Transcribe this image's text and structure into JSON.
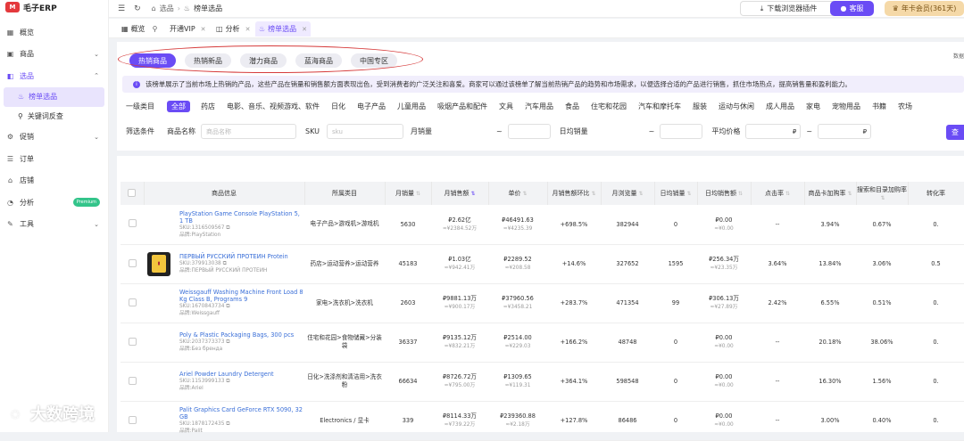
{
  "app": {
    "logo_mark": "M",
    "name": "毛子ERP"
  },
  "sidebar": {
    "items": [
      {
        "label": "概览",
        "icon": "grid-icon"
      },
      {
        "label": "商品",
        "icon": "box-icon"
      },
      {
        "label": "选品",
        "icon": "bag-icon"
      },
      {
        "label": "榜单选品",
        "icon": "flame-icon"
      },
      {
        "label": "关键词反查",
        "icon": "search-icon"
      },
      {
        "label": "促销",
        "icon": "gear-icon"
      },
      {
        "label": "订单",
        "icon": "list-icon"
      },
      {
        "label": "店铺",
        "icon": "store-icon"
      },
      {
        "label": "分析",
        "icon": "chart-icon",
        "badge": "Premium"
      },
      {
        "label": "工具",
        "icon": "wrench-icon"
      }
    ]
  },
  "topbar": {
    "breadcrumb": [
      "选品",
      "榜单选品"
    ],
    "download_label": "下载浏览器插件",
    "service_label": "客服",
    "vip_label": "年卡会员(361天)"
  },
  "tabs": [
    {
      "label": "概览"
    },
    {
      "label": "开通VIP"
    },
    {
      "label": "分析"
    },
    {
      "label": "榜单选品"
    }
  ],
  "sub_tabs": [
    "热销商品",
    "热销新品",
    "潜力商品",
    "蓝海商品",
    "中国专区"
  ],
  "data_source": "数据",
  "notice": "该榜单展示了当前市场上热销的产品，这些产品在销量和销售额方面表现出色，受到消费者的广泛关注和喜爱。商家可以通过该榜单了解当前热销产品的趋势和市场需求，以便选择合适的产品进行销售，抓住市场热点，提高销售量和盈利能力。",
  "categories": {
    "label": "一级类目",
    "items": [
      "全部",
      "药店",
      "电影、音乐、视频游戏、软件",
      "日化",
      "电子产品",
      "儿童用品",
      "吸烟产品和配件",
      "文具",
      "汽车用品",
      "食品",
      "住宅和花园",
      "汽车和摩托车",
      "服装",
      "运动与休闲",
      "成人用品",
      "家电",
      "宠物用品",
      "书籍",
      "农场"
    ]
  },
  "filters": {
    "label": "筛选条件",
    "name_label": "商品名称",
    "name_placeholder": "商品名称",
    "sku_label": "SKU",
    "sku_placeholder": "sku",
    "monthly_label": "月销量",
    "daily_label": "日均销量",
    "price_label": "平均价格",
    "dash": "~",
    "currency": "₽",
    "query_label": "查"
  },
  "table": {
    "headers": [
      "商品信息",
      "所属类目",
      "月销量",
      "月销售额",
      "单价",
      "月销售额环比",
      "月浏览量",
      "日均销量",
      "日均销售额",
      "点击率",
      "商品卡加购率",
      "搜索和目录加购率",
      "转化率"
    ],
    "rows": [
      {
        "name": "PlayStation Game Console PlayStation 5, 1 TB",
        "sku": "SKU:1316509567",
        "brand": "品牌:PlayStation",
        "category": "电子产品>游戏机>游戏机",
        "monthly_sales": "5630",
        "revenue": "₽2.62亿",
        "revenue_cny": "≈¥2384.52万",
        "price": "₽46491.63",
        "price_cny": "≈¥4235.39",
        "mom": "+698.5%",
        "views": "382944",
        "daily_sales": "0",
        "daily_rev": "₽0.00",
        "daily_rev_cny": "≈¥0.00",
        "ctr": "--",
        "card_add": "3.94%",
        "search_add": "0.67%",
        "conv": "0.",
        "img": false
      },
      {
        "name": "ПЕРВЫЙ РУССКИЙ ПРОТЕИН Protein",
        "sku": "SKU:379913038",
        "brand": "品牌:ПЕРВЫЙ РУССКИЙ ПРОТЕИН",
        "category": "药店>运动营养>运动营养",
        "monthly_sales": "45183",
        "revenue": "₽1.03亿",
        "revenue_cny": "≈¥942.41万",
        "price": "₽2289.52",
        "price_cny": "≈¥208.58",
        "mom": "+14.6%",
        "views": "327652",
        "daily_sales": "1595",
        "daily_rev": "₽256.34万",
        "daily_rev_cny": "≈¥23.35万",
        "ctr": "3.64%",
        "card_add": "13.84%",
        "search_add": "3.06%",
        "conv": "0.5",
        "img": true
      },
      {
        "name": "Weissgauff Washing Machine Front Load 8 Kg Class B, Programs 9",
        "sku": "SKU:1670843734",
        "brand": "品牌:Weissgauff",
        "category": "家电>洗衣机>洗衣机",
        "monthly_sales": "2603",
        "revenue": "₽9881.13万",
        "revenue_cny": "≈¥900.17万",
        "price": "₽37960.56",
        "price_cny": "≈¥3458.21",
        "mom": "+283.7%",
        "views": "471354",
        "daily_sales": "99",
        "daily_rev": "₽306.13万",
        "daily_rev_cny": "≈¥27.89万",
        "ctr": "2.42%",
        "card_add": "6.55%",
        "search_add": "0.51%",
        "conv": "0.",
        "img": false
      },
      {
        "name": "Poly & Plastic Packaging Bags, 300 pcs",
        "sku": "SKU:2037373373",
        "brand": "品牌:Без бренда",
        "category": "住宅和花园>食物储藏>分装袋",
        "monthly_sales": "36337",
        "revenue": "₽9135.12万",
        "revenue_cny": "≈¥832.21万",
        "price": "₽2514.00",
        "price_cny": "≈¥229.03",
        "mom": "+166.2%",
        "views": "48748",
        "daily_sales": "0",
        "daily_rev": "₽0.00",
        "daily_rev_cny": "≈¥0.00",
        "ctr": "--",
        "card_add": "20.18%",
        "search_add": "38.06%",
        "conv": "0.",
        "img": false
      },
      {
        "name": "Ariel Powder Laundry Detergent",
        "sku": "SKU:1153999133",
        "brand": "品牌:Ariel",
        "category": "日化>洗涤剂和清洁用>洗衣粉",
        "monthly_sales": "66634",
        "revenue": "₽8726.72万",
        "revenue_cny": "≈¥795.00万",
        "price": "₽1309.65",
        "price_cny": "≈¥119.31",
        "mom": "+364.1%",
        "views": "598548",
        "daily_sales": "0",
        "daily_rev": "₽0.00",
        "daily_rev_cny": "≈¥0.00",
        "ctr": "--",
        "card_add": "16.30%",
        "search_add": "1.56%",
        "conv": "0.",
        "img": false
      },
      {
        "name": "Palit Graphics Card GeForce RTX 5090, 32 GB",
        "sku": "SKU:1878172435",
        "brand": "品牌:Palit",
        "category": "Electronics / 显卡",
        "monthly_sales": "339",
        "revenue": "₽8114.33万",
        "revenue_cny": "≈¥739.22万",
        "price": "₽239360.88",
        "price_cny": "≈¥2.18万",
        "mom": "+127.8%",
        "views": "86486",
        "daily_sales": "0",
        "daily_rev": "₽0.00",
        "daily_rev_cny": "≈¥0.00",
        "ctr": "--",
        "card_add": "3.00%",
        "search_add": "0.40%",
        "conv": "0.",
        "img": false
      }
    ]
  },
  "watermark": "大数跨境"
}
